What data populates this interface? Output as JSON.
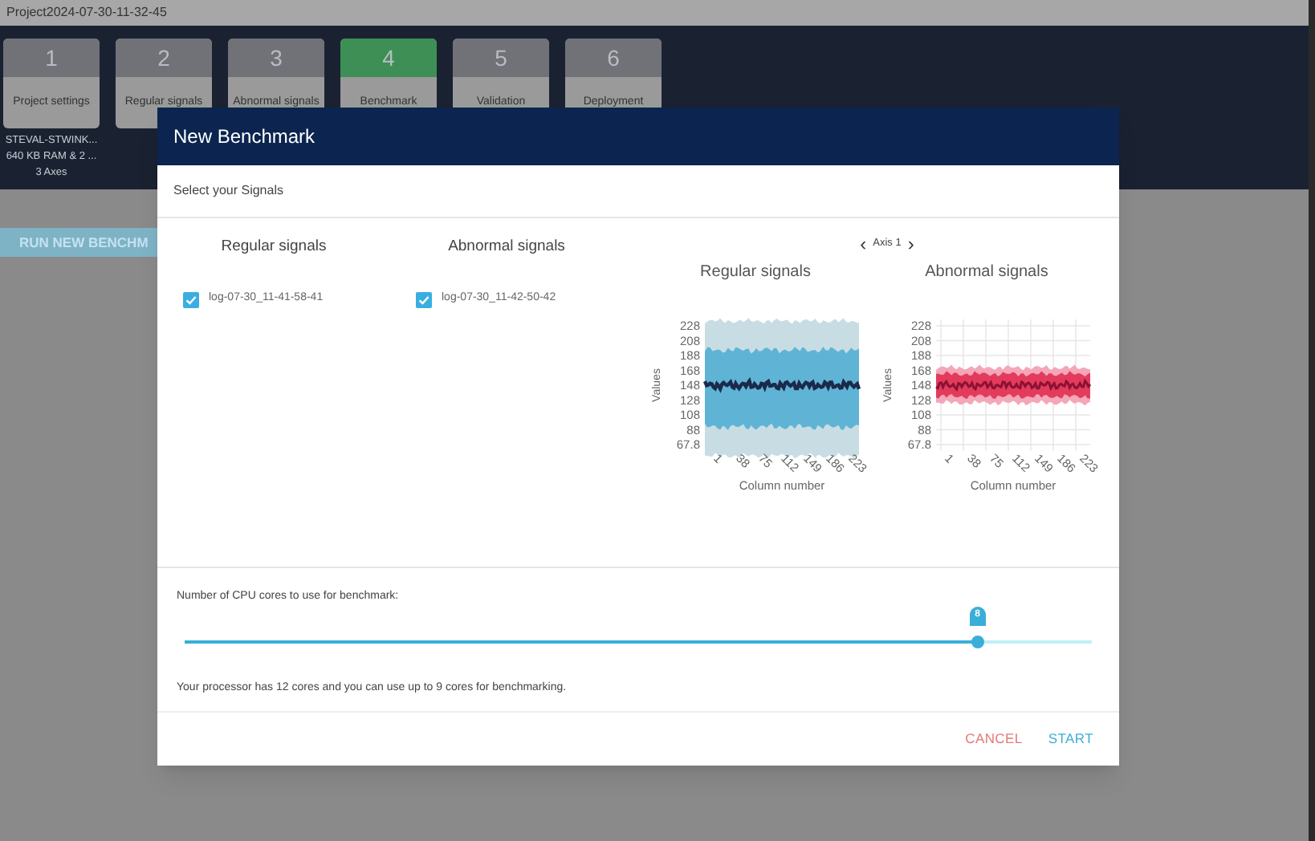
{
  "window": {
    "title": "Project2024-07-30-11-32-45"
  },
  "steps": [
    {
      "number": "1",
      "label": "Project settings",
      "selected": false,
      "info": [
        "STEVAL-STWINK...",
        "640 KB RAM & 2 ...",
        "3 Axes"
      ]
    },
    {
      "number": "2",
      "label": "Regular signals",
      "selected": false
    },
    {
      "number": "3",
      "label": "Abnormal signals",
      "selected": false
    },
    {
      "number": "4",
      "label": "Benchmark",
      "selected": true
    },
    {
      "number": "5",
      "label": "Validation",
      "selected": false
    },
    {
      "number": "6",
      "label": "Deployment",
      "selected": false
    }
  ],
  "run_button": "RUN NEW BENCHM",
  "dialog": {
    "title": "New Benchmark",
    "subtitle": "Select your Signals",
    "signal_columns": [
      {
        "heading": "Regular signals",
        "items": [
          {
            "label": "log-07-30_11-41-58-41",
            "checked": true
          }
        ]
      },
      {
        "heading": "Abnormal signals",
        "items": [
          {
            "label": "log-07-30_11-42-50-42",
            "checked": true
          }
        ]
      }
    ],
    "axis_selector": {
      "prev": "‹",
      "label": "Axis 1",
      "next": "›"
    },
    "charts": [
      {
        "title": "Regular signals",
        "ylabel": "Values",
        "xlabel": "Column number",
        "yticks": [
          "228",
          "208",
          "188",
          "168",
          "148",
          "128",
          "108",
          "88",
          "67.8"
        ],
        "xticks": [
          "1",
          "38",
          "75",
          "112",
          "149",
          "186",
          "223"
        ],
        "kind": "regular"
      },
      {
        "title": "Abnormal signals",
        "ylabel": "Values",
        "xlabel": "Column number",
        "yticks": [
          "228",
          "208",
          "188",
          "168",
          "148",
          "128",
          "108",
          "88",
          "67.8"
        ],
        "xticks": [
          "1",
          "38",
          "75",
          "112",
          "149",
          "186",
          "223"
        ],
        "kind": "abnormal"
      }
    ],
    "cores": {
      "label": "Number of CPU cores to use for benchmark:",
      "value": "8",
      "level": 0.874,
      "note": "Your processor has 12 cores and you can use up to 9 cores for benchmarking."
    },
    "buttons": [
      {
        "label": "CANCEL",
        "kind": "cancel"
      },
      {
        "label": "START",
        "kind": "start"
      }
    ]
  }
}
